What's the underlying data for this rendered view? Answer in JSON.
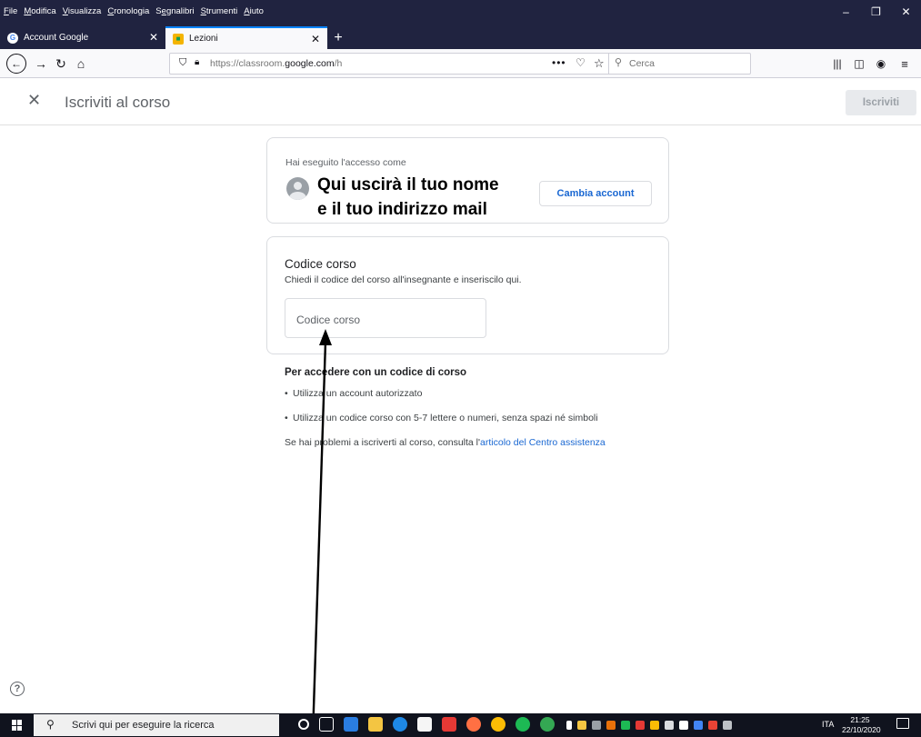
{
  "menubar": {
    "items": [
      {
        "underline": "F",
        "rest": "ile"
      },
      {
        "underline": "M",
        "rest": "odifica"
      },
      {
        "underline": "V",
        "rest": "isualizza"
      },
      {
        "underline": "C",
        "rest": "ronologia"
      },
      {
        "pre": "S",
        "underline": "e",
        "rest": "gnalibri"
      },
      {
        "underline": "S",
        "rest": "trumenti"
      },
      {
        "underline": "A",
        "rest": "iuto"
      }
    ]
  },
  "window_controls": {
    "minimize": "–",
    "maximize": "❐",
    "close": "✕"
  },
  "tabs": [
    {
      "label": "Account Google",
      "favicon": "G",
      "active": false
    },
    {
      "label": "Lezioni",
      "favicon": "■",
      "active": true
    }
  ],
  "new_tab_label": "+",
  "toolbar": {
    "url_prefix": "https://classroom.",
    "url_domain": "google.com",
    "url_suffix": "/h",
    "search_placeholder": "Cerca",
    "page_actions": "•••"
  },
  "classroom": {
    "header_title": "Iscriviti al corso",
    "join_button": "Iscriviti",
    "account_card": {
      "label": "Hai eseguito l'accesso come",
      "annotation_line1": "Qui uscirà il tuo nome",
      "annotation_line2": "e il tuo indirizzo mail",
      "switch_button": "Cambia account"
    },
    "code_card": {
      "title": "Codice corso",
      "description": "Chiedi il codice del corso all'insegnante e inseriscilo qui.",
      "input_placeholder": "Codice corso"
    },
    "help": {
      "title": "Per accedere con un codice di corso",
      "items": [
        "Utilizza un account autorizzato",
        "Utilizza un codice corso con 5-7 lettere o numeri, senza spazi né simboli"
      ],
      "footer_text": "Se hai problemi a iscriverti al corso, consulta l'",
      "footer_link": "articolo del Centro assistenza"
    },
    "help_icon": "?"
  },
  "taskbar": {
    "search_placeholder": "Scrivi qui per eseguire la ricerca",
    "language": "ITA",
    "time": "21:25",
    "date": "22/10/2020"
  },
  "colors": {
    "accent_blue": "#1967d2",
    "firefox_dark": "#202340",
    "annotation_arrow": "#000000"
  }
}
